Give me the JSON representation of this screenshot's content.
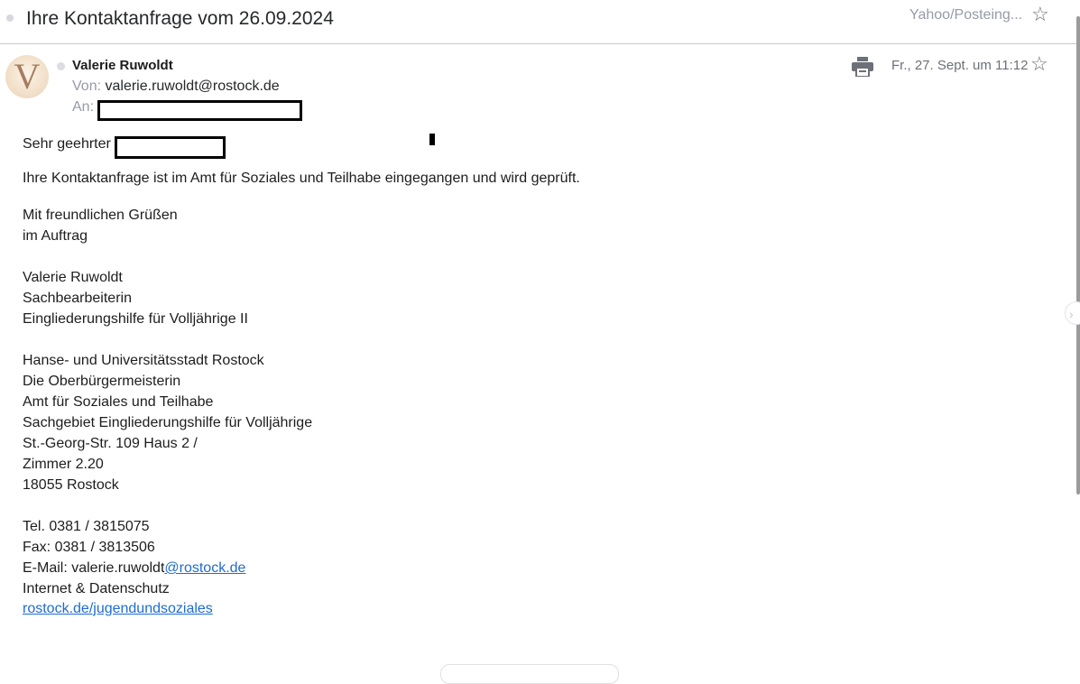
{
  "header": {
    "subject": "Ihre Kontaktanfrage vom 26.09.2024",
    "folder": "Yahoo/Posteing...",
    "star_icon": "star-outline-icon"
  },
  "message": {
    "avatar_letter": "V",
    "sender_name": "Valerie Ruwoldt",
    "from_label": "Von:",
    "from_email": "valerie.ruwoldt@rostock.de",
    "to_label": "An:",
    "date": "Fr., 27. Sept. um 11:12",
    "print_icon": "printer-icon"
  },
  "body": {
    "greeting": "Sehr geehrter",
    "intro": "Ihre Kontaktanfrage ist im Amt für Soziales und Teilhabe eingegangen und wird geprüft.",
    "closing_1": "Mit freundlichen Grüßen",
    "closing_2": "im Auftrag",
    "sig_name": "Valerie Ruwoldt",
    "sig_role": "Sachbearbeiterin",
    "sig_dept": "Eingliederungshilfe für Volljährige II",
    "org_1": "Hanse- und Universitätsstadt Rostock",
    "org_2": "Die Oberbürgermeisterin",
    "org_3": "Amt für Soziales und Teilhabe",
    "org_4": "Sachgebiet Eingliederungshilfe für Volljährige",
    "addr_1": "St.-Georg-Str. 109 Haus 2 /",
    "addr_2": "Zimmer 2.20",
    "addr_3": "18055 Rostock",
    "tel": "Tel. 0381 / 3815075",
    "fax": "Fax: 0381 / 3813506",
    "email_prefix": "E-Mail: valerie.ruwoldt",
    "email_link": "@rostock.de",
    "internet": "Internet & Datenschutz",
    "web_link": "rostock.de/jugendundsoziales"
  }
}
